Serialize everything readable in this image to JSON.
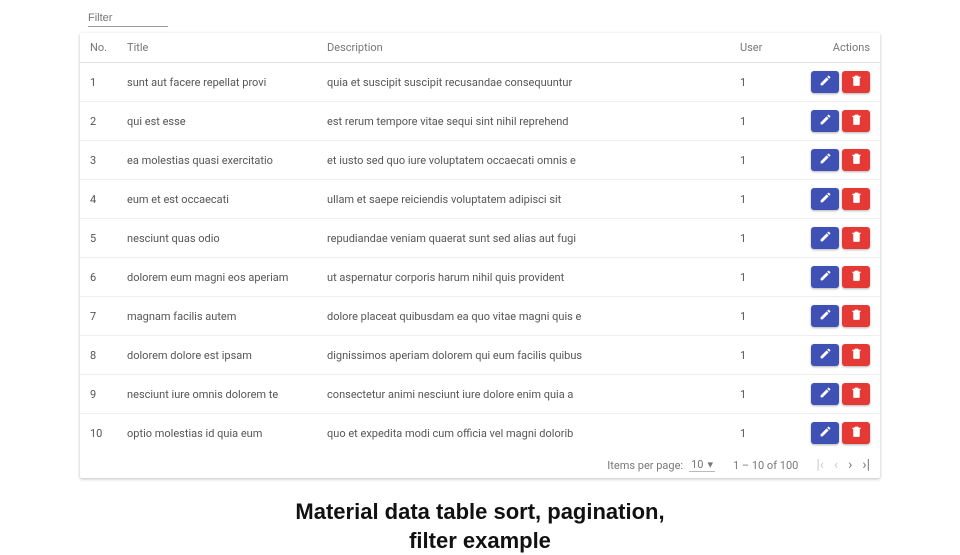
{
  "filter": {
    "placeholder": "Filter"
  },
  "headers": {
    "no": "No.",
    "title": "Title",
    "desc": "Description",
    "user": "User",
    "actions": "Actions"
  },
  "rows": [
    {
      "no": "1",
      "title": "sunt aut facere repellat provi",
      "desc": "quia et suscipit suscipit recusandae consequuntur",
      "user": "1"
    },
    {
      "no": "2",
      "title": "qui est esse",
      "desc": "est rerum tempore vitae sequi sint nihil reprehend",
      "user": "1"
    },
    {
      "no": "3",
      "title": "ea molestias quasi exercitatio",
      "desc": "et iusto sed quo iure voluptatem occaecati omnis e",
      "user": "1"
    },
    {
      "no": "4",
      "title": "eum et est occaecati",
      "desc": "ullam et saepe reiciendis voluptatem adipisci sit",
      "user": "1"
    },
    {
      "no": "5",
      "title": "nesciunt quas odio",
      "desc": "repudiandae veniam quaerat sunt sed alias aut fugi",
      "user": "1"
    },
    {
      "no": "6",
      "title": "dolorem eum magni eos aperiam",
      "desc": "ut aspernatur corporis harum nihil quis provident",
      "user": "1"
    },
    {
      "no": "7",
      "title": "magnam facilis autem",
      "desc": "dolore placeat quibusdam ea quo vitae magni quis e",
      "user": "1"
    },
    {
      "no": "8",
      "title": "dolorem dolore est ipsam",
      "desc": "dignissimos aperiam dolorem qui eum facilis quibus",
      "user": "1"
    },
    {
      "no": "9",
      "title": "nesciunt iure omnis dolorem te",
      "desc": "consectetur animi nesciunt iure dolore enim quia a",
      "user": "1"
    },
    {
      "no": "10",
      "title": "optio molestias id quia eum",
      "desc": "quo et expedita modi cum officia vel magni dolorib",
      "user": "1"
    }
  ],
  "paginator": {
    "items_per_page_label": "Items per page:",
    "page_size": "10",
    "range_label": "1 – 10 of 100"
  },
  "caption": {
    "line1": "Material data table sort, pagination,",
    "line2": "filter example"
  },
  "colors": {
    "edit": "#3f51b5",
    "delete": "#e53935"
  }
}
